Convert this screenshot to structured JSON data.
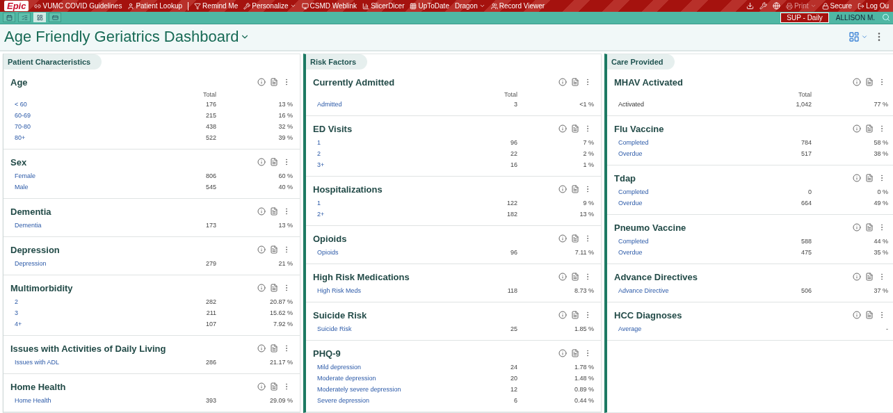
{
  "top_bar": {
    "logo": "Epic",
    "items": [
      {
        "label": "VUMC COVID Guidelines",
        "dropdown": false,
        "disabled": false
      },
      {
        "label": "Patient Lookup",
        "dropdown": false,
        "disabled": false
      },
      {
        "label": "Remind Me",
        "dropdown": false,
        "disabled": false
      },
      {
        "label": "Personalize",
        "dropdown": true,
        "disabled": false
      },
      {
        "label": "CSMD Weblink",
        "dropdown": false,
        "disabled": false
      },
      {
        "label": "SlicerDicer",
        "dropdown": false,
        "disabled": false
      },
      {
        "label": "UpToDate",
        "dropdown": false,
        "disabled": false
      },
      {
        "label": "Dragon",
        "dropdown": true,
        "disabled": false
      },
      {
        "label": "Record Viewer",
        "dropdown": false,
        "disabled": false
      }
    ],
    "right_items": [
      {
        "label": "Print",
        "dropdown": true,
        "disabled": true
      },
      {
        "label": "Secure",
        "dropdown": false,
        "disabled": false
      },
      {
        "label": "Log Ou",
        "dropdown": false,
        "disabled": false
      }
    ]
  },
  "activity_bar": {
    "tabs": [
      {
        "selected": false
      },
      {
        "selected": false
      },
      {
        "selected": true
      },
      {
        "selected": false
      }
    ],
    "environment": "SUP - Daily",
    "user": "ALLISON M."
  },
  "dashboard": {
    "title": "Age Friendly Geriatrics Dashboard"
  },
  "columns": [
    {
      "title": "Patient Characteristics",
      "accent": false,
      "widgets": [
        {
          "title": "Age",
          "total_header": "Total",
          "rows": [
            {
              "label": "< 60",
              "count": "176",
              "percent": "13 %",
              "link": true
            },
            {
              "label": "60-69",
              "count": "215",
              "percent": "16 %",
              "link": true
            },
            {
              "label": "70-80",
              "count": "438",
              "percent": "32 %",
              "link": true
            },
            {
              "label": "80+",
              "count": "522",
              "percent": "39 %",
              "link": true
            }
          ]
        },
        {
          "title": "Sex",
          "rows": [
            {
              "label": "Female",
              "count": "806",
              "percent": "60 %",
              "link": true
            },
            {
              "label": "Male",
              "count": "545",
              "percent": "40 %",
              "link": true
            }
          ]
        },
        {
          "title": "Dementia",
          "rows": [
            {
              "label": "Dementia",
              "count": "173",
              "percent": "13 %",
              "link": true
            }
          ]
        },
        {
          "title": "Depression",
          "rows": [
            {
              "label": "Depression",
              "count": "279",
              "percent": "21 %",
              "link": true
            }
          ]
        },
        {
          "title": "Multimorbidity",
          "rows": [
            {
              "label": "2",
              "count": "282",
              "percent": "20.87 %",
              "link": true
            },
            {
              "label": "3",
              "count": "211",
              "percent": "15.62 %",
              "link": true
            },
            {
              "label": "4+",
              "count": "107",
              "percent": "7.92 %",
              "link": true
            }
          ]
        },
        {
          "title": "Issues with Activities of Daily Living",
          "rows": [
            {
              "label": "Issues with ADL",
              "count": "286",
              "percent": "21.17 %",
              "link": true
            }
          ]
        },
        {
          "title": "Home Health",
          "rows": [
            {
              "label": "Home Health",
              "count": "393",
              "percent": "29.09 %",
              "link": true
            }
          ]
        }
      ]
    },
    {
      "title": "Risk Factors",
      "accent": true,
      "widgets": [
        {
          "title": "Currently Admitted",
          "total_header": "Total",
          "rows": [
            {
              "label": "Admitted",
              "count": "3",
              "percent": "<1 %",
              "link": true
            }
          ]
        },
        {
          "title": "ED Visits",
          "rows": [
            {
              "label": "1",
              "count": "96",
              "percent": "7 %",
              "link": true
            },
            {
              "label": "2",
              "count": "22",
              "percent": "2 %",
              "link": true
            },
            {
              "label": "3+",
              "count": "16",
              "percent": "1 %",
              "link": true
            }
          ]
        },
        {
          "title": "Hospitalizations",
          "rows": [
            {
              "label": "1",
              "count": "122",
              "percent": "9 %",
              "link": true
            },
            {
              "label": "2+",
              "count": "182",
              "percent": "13 %",
              "link": true
            }
          ]
        },
        {
          "title": "Opioids",
          "rows": [
            {
              "label": "Opioids",
              "count": "96",
              "percent": "7.11 %",
              "link": true
            }
          ]
        },
        {
          "title": "High Risk Medications",
          "rows": [
            {
              "label": "High Risk Meds",
              "count": "118",
              "percent": "8.73 %",
              "link": true
            }
          ]
        },
        {
          "title": "Suicide Risk",
          "rows": [
            {
              "label": "Suicide Risk",
              "count": "25",
              "percent": "1.85 %",
              "link": true
            }
          ]
        },
        {
          "title": "PHQ-9",
          "rows": [
            {
              "label": "Mild depression",
              "count": "24",
              "percent": "1.78 %",
              "link": true
            },
            {
              "label": "Moderate depression",
              "count": "20",
              "percent": "1.48 %",
              "link": true
            },
            {
              "label": "Moderately severe depression",
              "count": "12",
              "percent": "0.89 %",
              "link": true
            },
            {
              "label": "Severe depression",
              "count": "6",
              "percent": "0.44 %",
              "link": true
            }
          ]
        }
      ]
    },
    {
      "title": "Care Provided",
      "accent": true,
      "widgets": [
        {
          "title": "MHAV Activated",
          "total_header": "Total",
          "rows": [
            {
              "label": "Activated",
              "count": "1,042",
              "percent": "77 %",
              "link": false
            }
          ]
        },
        {
          "title": "Flu Vaccine",
          "rows": [
            {
              "label": "Completed",
              "count": "784",
              "percent": "58 %",
              "link": true
            },
            {
              "label": "Overdue",
              "count": "517",
              "percent": "38 %",
              "link": true
            }
          ]
        },
        {
          "title": "Tdap",
          "rows": [
            {
              "label": "Completed",
              "count": "0",
              "percent": "0 %",
              "link": true
            },
            {
              "label": "Overdue",
              "count": "664",
              "percent": "49 %",
              "link": true
            }
          ]
        },
        {
          "title": "Pneumo Vaccine",
          "rows": [
            {
              "label": "Completed",
              "count": "588",
              "percent": "44 %",
              "link": true
            },
            {
              "label": "Overdue",
              "count": "475",
              "percent": "35 %",
              "link": true
            }
          ]
        },
        {
          "title": "Advance Directives",
          "rows": [
            {
              "label": "Advance Directive",
              "count": "506",
              "percent": "37 %",
              "link": true
            }
          ]
        },
        {
          "title": "HCC Diagnoses",
          "rows": [
            {
              "label": "Average",
              "count": "",
              "percent": "-",
              "link": true
            }
          ]
        }
      ]
    }
  ]
}
